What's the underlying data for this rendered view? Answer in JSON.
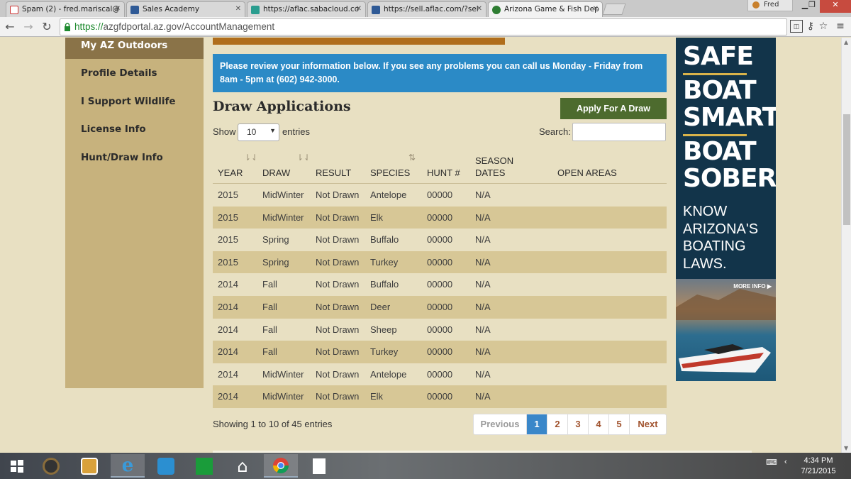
{
  "browser": {
    "tabs": [
      {
        "title": "Spam (2) - fred.mariscal@",
        "active": false
      },
      {
        "title": "Sales Academy",
        "active": false
      },
      {
        "title": "https://aflac.sabacloud.co",
        "active": false
      },
      {
        "title": "https://sell.aflac.com/?sel",
        "active": false
      },
      {
        "title": "Arizona Game & Fish Dep",
        "active": true
      }
    ],
    "user_name": "Fred",
    "url_scheme": "https://",
    "url_rest": "azgfdportal.az.gov/AccountManagement"
  },
  "sidebar": {
    "items": [
      {
        "label": "My AZ Outdoors",
        "active": true
      },
      {
        "label": "Profile Details",
        "active": false
      },
      {
        "label": "I Support Wildlife",
        "active": false
      },
      {
        "label": "License Info",
        "active": false
      },
      {
        "label": "Hunt/Draw Info",
        "active": false
      }
    ]
  },
  "main": {
    "info_text": "Please review your information below. If you see any problems you can call us Monday - Friday from 8am - 5pm at (602) 942-3000.",
    "title": "Draw Applications",
    "apply_button": "Apply For A Draw",
    "show_label": "Show",
    "entries_label": "entries",
    "page_length": "10",
    "search_label": "Search:",
    "search_value": "",
    "columns": [
      "YEAR",
      "DRAW",
      "RESULT",
      "SPECIES",
      "HUNT #",
      "SEASON DATES",
      "OPEN AREAS"
    ],
    "rows": [
      [
        "2015",
        "MidWinter",
        "Not Drawn",
        "Antelope",
        "00000",
        "N/A",
        ""
      ],
      [
        "2015",
        "MidWinter",
        "Not Drawn",
        "Elk",
        "00000",
        "N/A",
        ""
      ],
      [
        "2015",
        "Spring",
        "Not Drawn",
        "Buffalo",
        "00000",
        "N/A",
        ""
      ],
      [
        "2015",
        "Spring",
        "Not Drawn",
        "Turkey",
        "00000",
        "N/A",
        ""
      ],
      [
        "2014",
        "Fall",
        "Not Drawn",
        "Buffalo",
        "00000",
        "N/A",
        ""
      ],
      [
        "2014",
        "Fall",
        "Not Drawn",
        "Deer",
        "00000",
        "N/A",
        ""
      ],
      [
        "2014",
        "Fall",
        "Not Drawn",
        "Sheep",
        "00000",
        "N/A",
        ""
      ],
      [
        "2014",
        "Fall",
        "Not Drawn",
        "Turkey",
        "00000",
        "N/A",
        ""
      ],
      [
        "2014",
        "MidWinter",
        "Not Drawn",
        "Antelope",
        "00000",
        "N/A",
        ""
      ],
      [
        "2014",
        "MidWinter",
        "Not Drawn",
        "Elk",
        "00000",
        "N/A",
        ""
      ]
    ],
    "footer_info": "Showing 1 to 10 of 45 entries",
    "pagination": {
      "previous": "Previous",
      "pages": [
        "1",
        "2",
        "3",
        "4",
        "5"
      ],
      "current": "1",
      "next": "Next"
    }
  },
  "ad": {
    "lines": [
      "SAFE",
      "BOAT",
      "SMART",
      "BOAT",
      "SOBER"
    ],
    "sub": [
      "KNOW",
      "ARIZONA'S",
      "BOATING",
      "LAWS."
    ],
    "more": "MORE INFO",
    "colors": {
      "bg": "#12344a",
      "rule": "#d9b34a"
    }
  },
  "taskbar": {
    "time": "4:34 PM",
    "date": "7/21/2015"
  },
  "colors": {
    "page_bg": "#e8e0c2",
    "sidebar_bg": "#c7b27d",
    "sidebar_active": "#8a7348",
    "info_blue": "#2b8ac6",
    "apply_green": "#4d6b2e",
    "row_stripe": "#d7c796",
    "page_current": "#3a87c9"
  }
}
